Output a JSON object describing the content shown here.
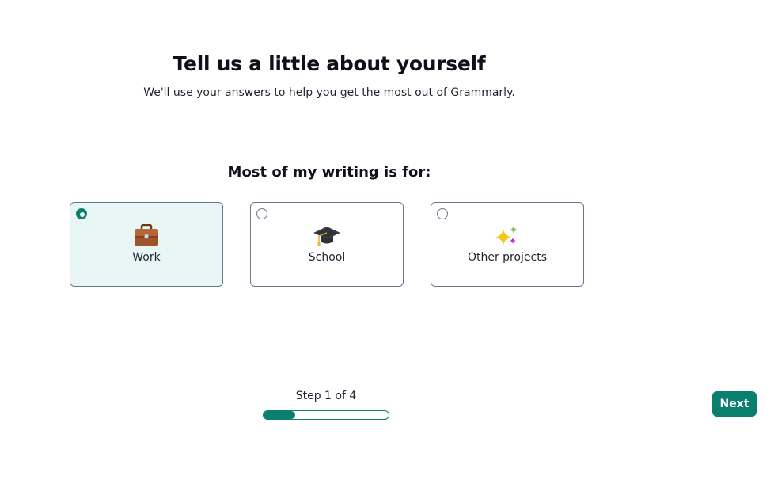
{
  "header": {
    "title": "Tell us a little about yourself",
    "subtitle": "We'll use your answers to help you get the most out of Grammarly."
  },
  "question": {
    "label": "Most of my writing is for:",
    "options": [
      {
        "label": "Work",
        "icon": "briefcase-icon",
        "selected": true
      },
      {
        "label": "School",
        "icon": "graduation-cap-icon",
        "selected": false
      },
      {
        "label": "Other projects",
        "icon": "sparkles-icon",
        "selected": false
      }
    ]
  },
  "progress": {
    "step_text": "Step 1 of 4",
    "current": 1,
    "total": 4,
    "fraction": 0.25
  },
  "footer": {
    "next_label": "Next"
  },
  "colors": {
    "accent": "#0a7f6e",
    "selected_bg": "#e8f7f5",
    "card_border": "#6d758d"
  }
}
